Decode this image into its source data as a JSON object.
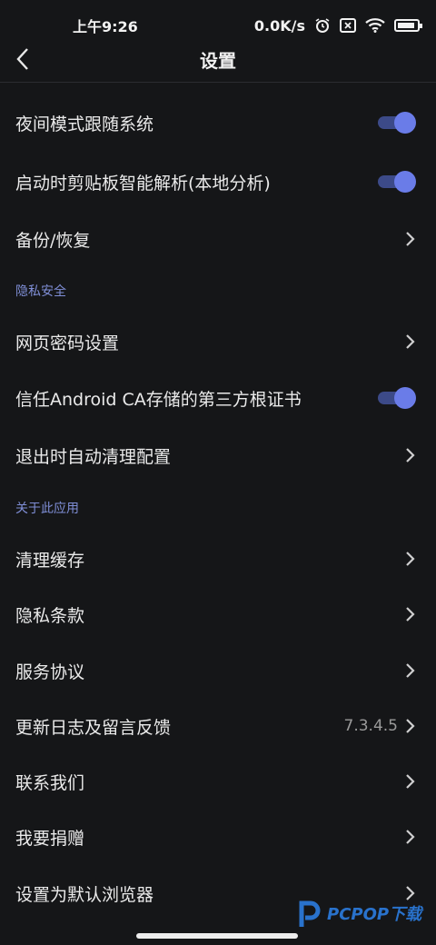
{
  "status": {
    "time": "上午9:26",
    "net_speed": "0.0K/s"
  },
  "header": {
    "title": "设置"
  },
  "rows": [
    {
      "label": "夜间模式跟随系统"
    },
    {
      "label": "启动时剪贴板智能解析(本地分析)"
    },
    {
      "label": "备份/恢复"
    },
    {
      "label": "网页密码设置"
    },
    {
      "label": "信任Android CA存储的第三方根证书"
    },
    {
      "label": "退出时自动清理配置"
    },
    {
      "label": "清理缓存"
    },
    {
      "label": "隐私条款"
    },
    {
      "label": "服务协议"
    },
    {
      "label": "更新日志及留言反馈",
      "value": "7.3.4.5"
    },
    {
      "label": "联系我们"
    },
    {
      "label": "我要捐赠"
    },
    {
      "label": "设置为默认浏览器"
    }
  ],
  "sections": {
    "privacy": "隐私安全",
    "about": "关于此应用"
  },
  "watermark": {
    "text": "PCPOP下载"
  },
  "colors": {
    "accent": "#6a7ce8",
    "section": "#7f8ed6",
    "background": "#151618"
  }
}
